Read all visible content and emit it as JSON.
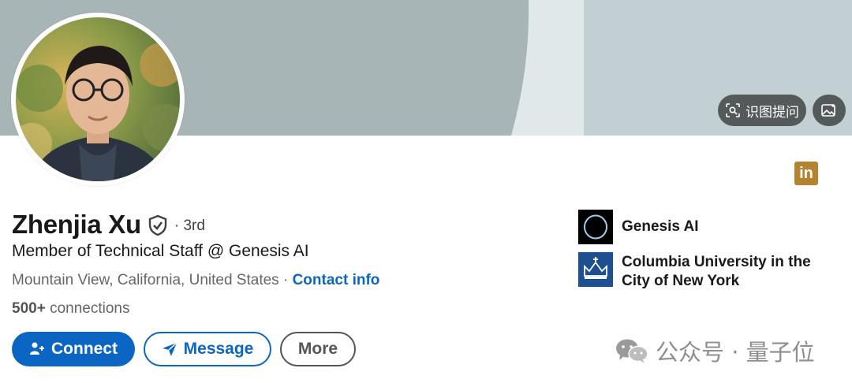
{
  "profile": {
    "name": "Zhenjia Xu",
    "degree": "· 3rd",
    "headline": "Member of Technical Staff @ Genesis AI",
    "location": "Mountain View, California, United States",
    "separator": " · ",
    "contact_label": "Contact info",
    "connections_count": "500+",
    "connections_label": "connections"
  },
  "actions": {
    "connect_label": "Connect",
    "message_label": "Message",
    "more_label": "More"
  },
  "organizations": [
    {
      "name": "Genesis AI",
      "logo": "genesis-ai-logo"
    },
    {
      "name": "Columbia University in the City of New York",
      "logo": "columbia-crown-logo"
    }
  ],
  "overlay": {
    "ocr_button_label": "识图提问",
    "image_button_icon": "image-icon"
  },
  "watermark": {
    "text": "公众号 · 量子位"
  },
  "colors": {
    "primary": "#0a66c2",
    "banner": "#a8b5b7",
    "linkedin_badge": "#b5832f",
    "columbia_blue": "#1d4f91"
  }
}
